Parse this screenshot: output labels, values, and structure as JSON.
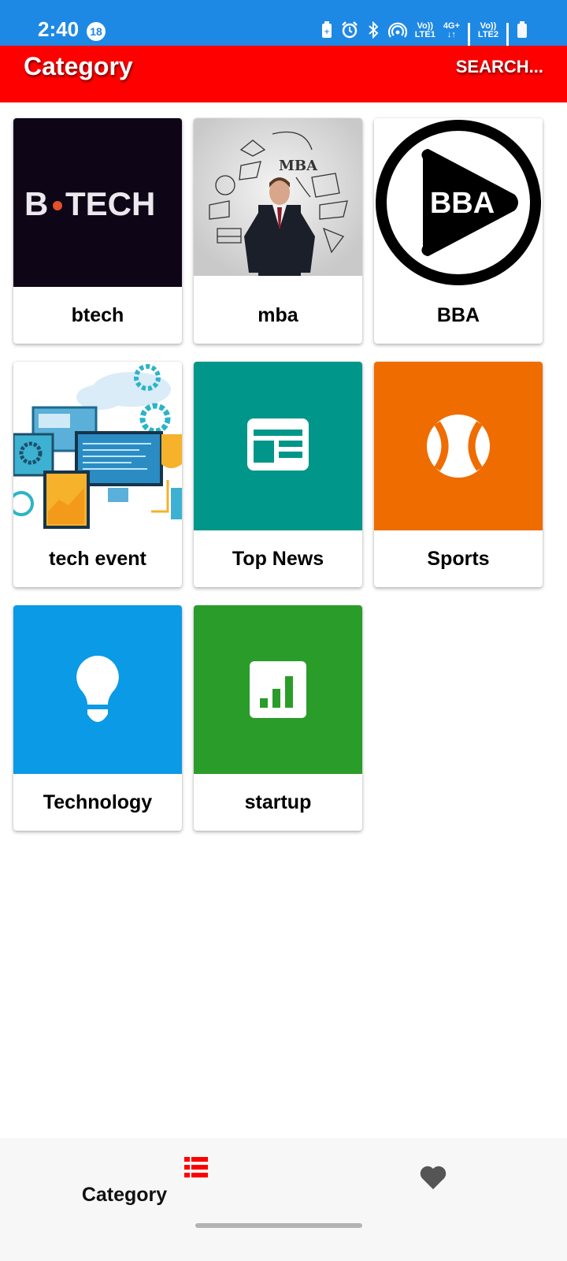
{
  "status_bar": {
    "time": "2:40",
    "notification_count": "18",
    "sim1_label_top": "Vo))",
    "sim1_label_bottom": "LTE1",
    "network_type": "4G+",
    "sim2_label_top": "Vo))",
    "sim2_label_bottom": "LTE2",
    "icons": [
      "battery-saver-icon",
      "alarm-icon",
      "bluetooth-icon",
      "hotspot-icon",
      "signal-icon",
      "signal-icon",
      "battery-icon"
    ]
  },
  "app_bar": {
    "title": "Category",
    "search_label": "SEARCH...",
    "background_color": "#ff0000"
  },
  "categories": [
    {
      "label": "btech",
      "thumb": "btech-logo",
      "thumb_text": "B",
      "thumb_text_2": "TECH"
    },
    {
      "label": "mba",
      "thumb": "mba-photo",
      "thumb_text": "MBA"
    },
    {
      "label": "BBA",
      "thumb": "bba-play-logo",
      "thumb_text": "BBA"
    },
    {
      "label": "tech event",
      "thumb": "tech-event-illustration"
    },
    {
      "label": "Top News",
      "thumb": "newspaper-icon",
      "color": "#00968a"
    },
    {
      "label": "Sports",
      "thumb": "ball-icon",
      "color": "#ef6c00"
    },
    {
      "label": "Technology",
      "thumb": "lightbulb-icon",
      "color": "#0a9ae6"
    },
    {
      "label": "startup",
      "thumb": "bar-chart-icon",
      "color": "#2a9c2a"
    }
  ],
  "bottom_nav": {
    "items": [
      {
        "label": "Category",
        "icon": "list-icon",
        "active": true,
        "color": "#ff0000"
      },
      {
        "label": "",
        "icon": "heart-icon",
        "active": false,
        "color": "#555555"
      }
    ]
  }
}
